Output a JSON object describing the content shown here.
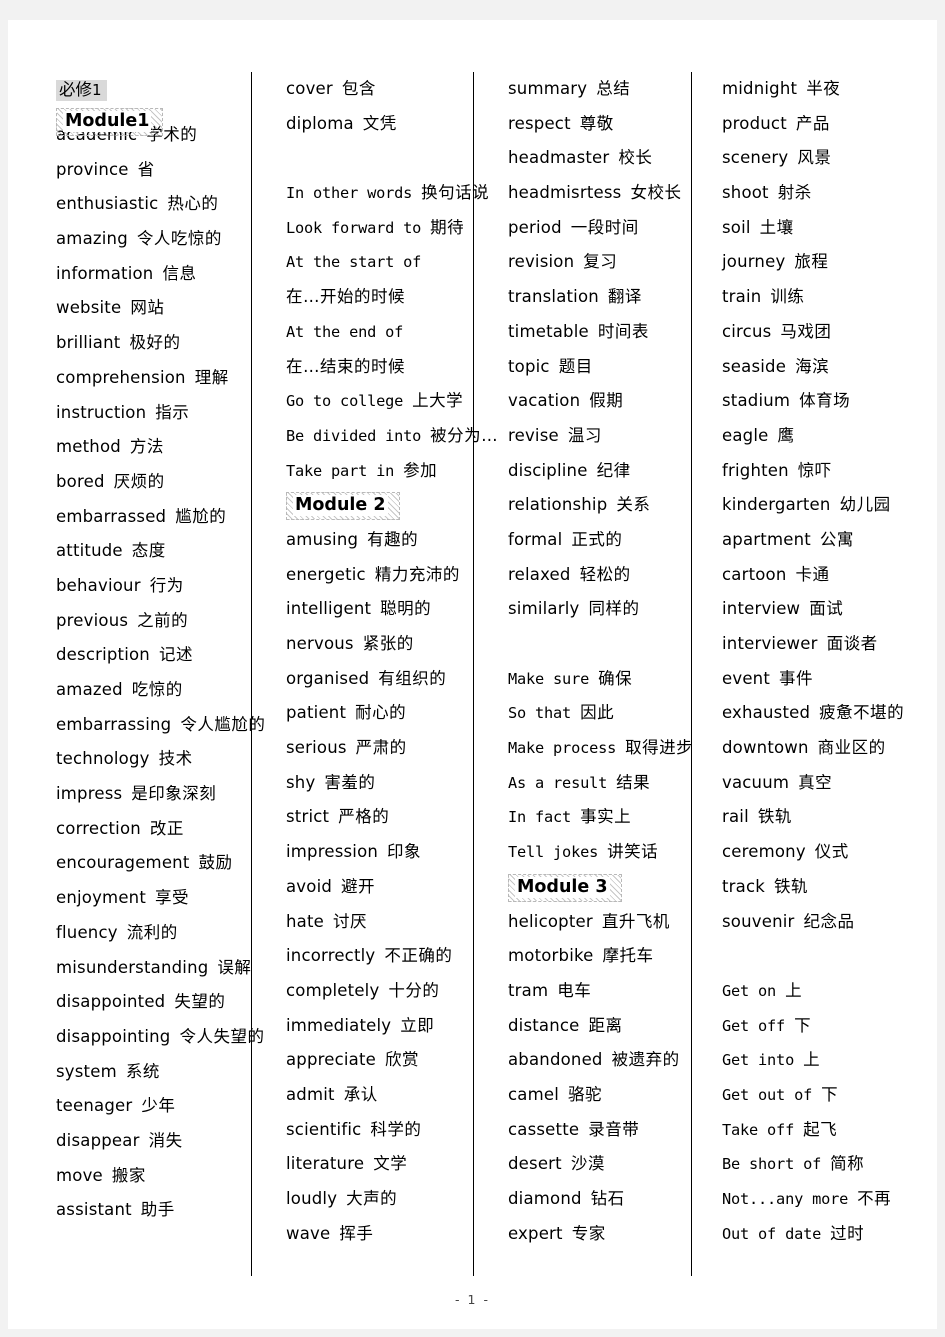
{
  "document": {
    "book_label": "必修",
    "book_number": "1",
    "page_number": "- 1 -"
  },
  "columns": [
    {
      "id": "column-1",
      "heading": "Module1",
      "entries": [
        {
          "en": "academic",
          "cn": "学术的"
        },
        {
          "en": "province",
          "cn": "省"
        },
        {
          "en": "enthusiastic",
          "cn": "热心的"
        },
        {
          "en": "amazing",
          "cn": "令人吃惊的"
        },
        {
          "en": "information",
          "cn": "信息"
        },
        {
          "en": "website",
          "cn": "网站"
        },
        {
          "en": "brilliant",
          "cn": "极好的"
        },
        {
          "en": "comprehension",
          "cn": "理解"
        },
        {
          "en": "instruction",
          "cn": "指示"
        },
        {
          "en": "method",
          "cn": "方法"
        },
        {
          "en": "bored",
          "cn": "厌烦的"
        },
        {
          "en": "embarrassed",
          "cn": "尴尬的"
        },
        {
          "en": "attitude",
          "cn": "态度"
        },
        {
          "en": "behaviour",
          "cn": "行为"
        },
        {
          "en": "previous",
          "cn": "之前的"
        },
        {
          "en": "description",
          "cn": "记述"
        },
        {
          "en": "amazed",
          "cn": "吃惊的"
        },
        {
          "en": "embarrassing",
          "cn": "令人尴尬的"
        },
        {
          "en": "technology",
          "cn": "技术"
        },
        {
          "en": "impress",
          "cn": "是印象深刻"
        },
        {
          "en": "correction",
          "cn": "改正"
        },
        {
          "en": "encouragement",
          "cn": "鼓励"
        },
        {
          "en": "enjoyment",
          "cn": "享受"
        },
        {
          "en": "fluency",
          "cn": "流利的"
        },
        {
          "en": "misunderstanding",
          "cn": "误解"
        },
        {
          "en": "disappointed",
          "cn": "失望的"
        },
        {
          "en": "disappointing",
          "cn": "令人失望的"
        },
        {
          "en": "system",
          "cn": "系统"
        },
        {
          "en": "teenager",
          "cn": "少年"
        },
        {
          "en": "disappear",
          "cn": "消失"
        },
        {
          "en": "move",
          "cn": "搬家"
        },
        {
          "en": "assistant",
          "cn": "助手"
        }
      ]
    },
    {
      "id": "column-2",
      "entries": [
        {
          "en": "cover",
          "cn": "包含"
        },
        {
          "en": "diploma",
          "cn": "文凭"
        },
        {
          "type": "blank"
        },
        {
          "en": "In other words",
          "cn": "换句话说",
          "phrase": true
        },
        {
          "en": "Look forward to",
          "cn": "期待",
          "phrase": true
        },
        {
          "en": "At the start of",
          "cn": "",
          "phrase": true
        },
        {
          "en": "",
          "cn": "在…开始的时候"
        },
        {
          "en": "At the end of",
          "cn": "",
          "phrase": true
        },
        {
          "en": "",
          "cn": "在…结束的时候"
        },
        {
          "en": "Go to college",
          "cn": "上大学",
          "phrase": true
        },
        {
          "en": "Be divided into",
          "cn": "被分为…",
          "phrase": true
        },
        {
          "en": "Take part in",
          "cn": "参加",
          "phrase": true
        },
        {
          "type": "module",
          "label": "Module 2"
        },
        {
          "en": "amusing",
          "cn": "有趣的"
        },
        {
          "en": "energetic",
          "cn": "精力充沛的"
        },
        {
          "en": "intelligent",
          "cn": "聪明的"
        },
        {
          "en": "nervous",
          "cn": "紧张的"
        },
        {
          "en": "organised",
          "cn": "有组织的"
        },
        {
          "en": "patient",
          "cn": "耐心的"
        },
        {
          "en": "serious",
          "cn": "严肃的"
        },
        {
          "en": "shy",
          "cn": "害羞的"
        },
        {
          "en": "strict",
          "cn": "严格的"
        },
        {
          "en": "impression",
          "cn": "印象"
        },
        {
          "en": "avoid",
          "cn": "避开"
        },
        {
          "en": "hate",
          "cn": "讨厌"
        },
        {
          "en": "incorrectly",
          "cn": "不正确的"
        },
        {
          "en": "completely",
          "cn": "十分的"
        },
        {
          "en": "immediately",
          "cn": "立即"
        },
        {
          "en": "appreciate",
          "cn": "欣赏"
        },
        {
          "en": "admit",
          "cn": "承认"
        },
        {
          "en": "scientific",
          "cn": "科学的"
        },
        {
          "en": "literature",
          "cn": "文学"
        },
        {
          "en": "loudly",
          "cn": "大声的"
        },
        {
          "en": "wave",
          "cn": "挥手"
        }
      ]
    },
    {
      "id": "column-3",
      "entries": [
        {
          "en": "summary",
          "cn": "总结"
        },
        {
          "en": "respect",
          "cn": "尊敬"
        },
        {
          "en": "headmaster",
          "cn": "校长"
        },
        {
          "en": "headmisrtess",
          "cn": "女校长"
        },
        {
          "en": "period",
          "cn": "一段时间"
        },
        {
          "en": "revision",
          "cn": "复习"
        },
        {
          "en": "translation",
          "cn": "翻译"
        },
        {
          "en": "timetable",
          "cn": "时间表"
        },
        {
          "en": "topic",
          "cn": "题目"
        },
        {
          "en": "vacation",
          "cn": "假期"
        },
        {
          "en": "revise",
          "cn": "温习"
        },
        {
          "en": "discipline",
          "cn": "纪律"
        },
        {
          "en": "relationship",
          "cn": "关系"
        },
        {
          "en": "formal",
          "cn": "正式的"
        },
        {
          "en": "relaxed",
          "cn": "轻松的"
        },
        {
          "en": "similarly",
          "cn": "同样的"
        },
        {
          "type": "blank"
        },
        {
          "en": "Make sure",
          "cn": "确保",
          "phrase": true
        },
        {
          "en": "So that",
          "cn": "因此",
          "phrase": true
        },
        {
          "en": "Make process",
          "cn": "取得进步",
          "phrase": true
        },
        {
          "en": "As a result",
          "cn": "结果",
          "phrase": true
        },
        {
          "en": "In fact",
          "cn": "事实上",
          "phrase": true
        },
        {
          "en": "Tell jokes",
          "cn": "讲笑话",
          "phrase": true
        },
        {
          "type": "module",
          "label": "Module 3"
        },
        {
          "en": "helicopter",
          "cn": "直升飞机"
        },
        {
          "en": "motorbike",
          "cn": "摩托车"
        },
        {
          "en": "tram",
          "cn": "电车"
        },
        {
          "en": "distance",
          "cn": "距离"
        },
        {
          "en": "abandoned",
          "cn": "被遗弃的"
        },
        {
          "en": "camel",
          "cn": "骆驼"
        },
        {
          "en": "cassette",
          "cn": "录音带"
        },
        {
          "en": "desert",
          "cn": "沙漠"
        },
        {
          "en": "diamond",
          "cn": "钻石"
        },
        {
          "en": "expert",
          "cn": "专家"
        }
      ]
    },
    {
      "id": "column-4",
      "entries": [
        {
          "en": "midnight",
          "cn": "半夜"
        },
        {
          "en": "product",
          "cn": "产品"
        },
        {
          "en": "scenery",
          "cn": "风景"
        },
        {
          "en": "shoot",
          "cn": "射杀"
        },
        {
          "en": "soil",
          "cn": "土壤"
        },
        {
          "en": "journey",
          "cn": "旅程"
        },
        {
          "en": "train",
          "cn": "训练"
        },
        {
          "en": "circus",
          "cn": "马戏团"
        },
        {
          "en": "seaside",
          "cn": "海滨"
        },
        {
          "en": "stadium",
          "cn": "体育场"
        },
        {
          "en": "eagle",
          "cn": "鹰"
        },
        {
          "en": "frighten",
          "cn": "惊吓"
        },
        {
          "en": "kindergarten",
          "cn": "幼儿园"
        },
        {
          "en": "apartment",
          "cn": "公寓"
        },
        {
          "en": "cartoon",
          "cn": "卡通"
        },
        {
          "en": "interview",
          "cn": "面试"
        },
        {
          "en": "interviewer",
          "cn": "面谈者"
        },
        {
          "en": "event",
          "cn": "事件"
        },
        {
          "en": "exhausted",
          "cn": "疲惫不堪的"
        },
        {
          "en": "downtown",
          "cn": "商业区的"
        },
        {
          "en": "vacuum",
          "cn": "真空"
        },
        {
          "en": "rail",
          "cn": "铁轨"
        },
        {
          "en": "ceremony",
          "cn": "仪式"
        },
        {
          "en": "track",
          "cn": "铁轨"
        },
        {
          "en": "souvenir",
          "cn": "纪念品"
        },
        {
          "type": "blank"
        },
        {
          "en": "Get on",
          "cn": "上",
          "phrase": true
        },
        {
          "en": "Get off",
          "cn": "下",
          "phrase": true
        },
        {
          "en": "Get into",
          "cn": "上",
          "phrase": true
        },
        {
          "en": "Get out of",
          "cn": "下",
          "phrase": true
        },
        {
          "en": "Take off",
          "cn": "起飞",
          "phrase": true
        },
        {
          "en": "Be short of",
          "cn": "简称",
          "phrase": true
        },
        {
          "en": "Not...any more",
          "cn": "不再",
          "phrase": true
        },
        {
          "en": "Out of date",
          "cn": "过时",
          "phrase": true
        }
      ]
    }
  ]
}
